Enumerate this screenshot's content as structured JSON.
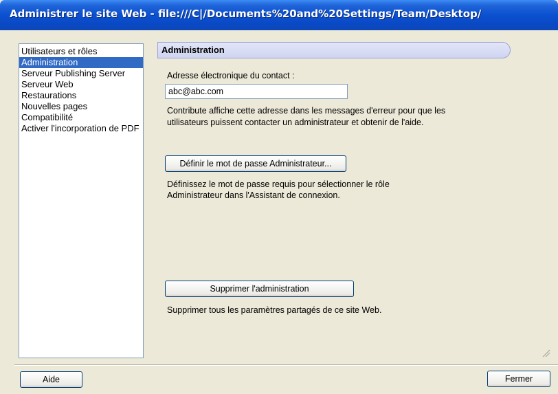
{
  "window": {
    "title": "Administrer le site Web - file:///C|/Documents%20and%20Settings/Team/Desktop/"
  },
  "sidebar": {
    "items": [
      {
        "label": "Utilisateurs et rôles",
        "selected": false
      },
      {
        "label": "Administration",
        "selected": true
      },
      {
        "label": "Serveur Publishing Server",
        "selected": false
      },
      {
        "label": "Serveur Web",
        "selected": false
      },
      {
        "label": "Restaurations",
        "selected": false
      },
      {
        "label": "Nouvelles pages",
        "selected": false
      },
      {
        "label": "Compatibilité",
        "selected": false
      },
      {
        "label": "Activer l'incorporation de PDF",
        "selected": false
      }
    ]
  },
  "panel": {
    "header": "Administration",
    "contact_label": "Adresse électronique du contact :",
    "contact_value": "abc@abc.com",
    "contact_help_1": "Contribute affiche cette adresse dans les messages d'erreur pour que les",
    "contact_help_2": "utilisateurs puissent contacter un administrateur et obtenir de l'aide.",
    "password_button": "Définir le mot de passe Administrateur...",
    "password_help_1": "Définissez le mot de passe requis pour sélectionner le rôle",
    "password_help_2": "Administrateur dans l'Assistant de connexion.",
    "remove_button": "Supprimer l'administration",
    "remove_help": "Supprimer tous les paramètres partagés de ce site Web."
  },
  "footer": {
    "help_button": "Aide",
    "close_button": "Fermer"
  },
  "colors": {
    "titlebar": "#0a49c4",
    "selection": "#316ac5",
    "dialog_bg": "#ece9d8"
  }
}
